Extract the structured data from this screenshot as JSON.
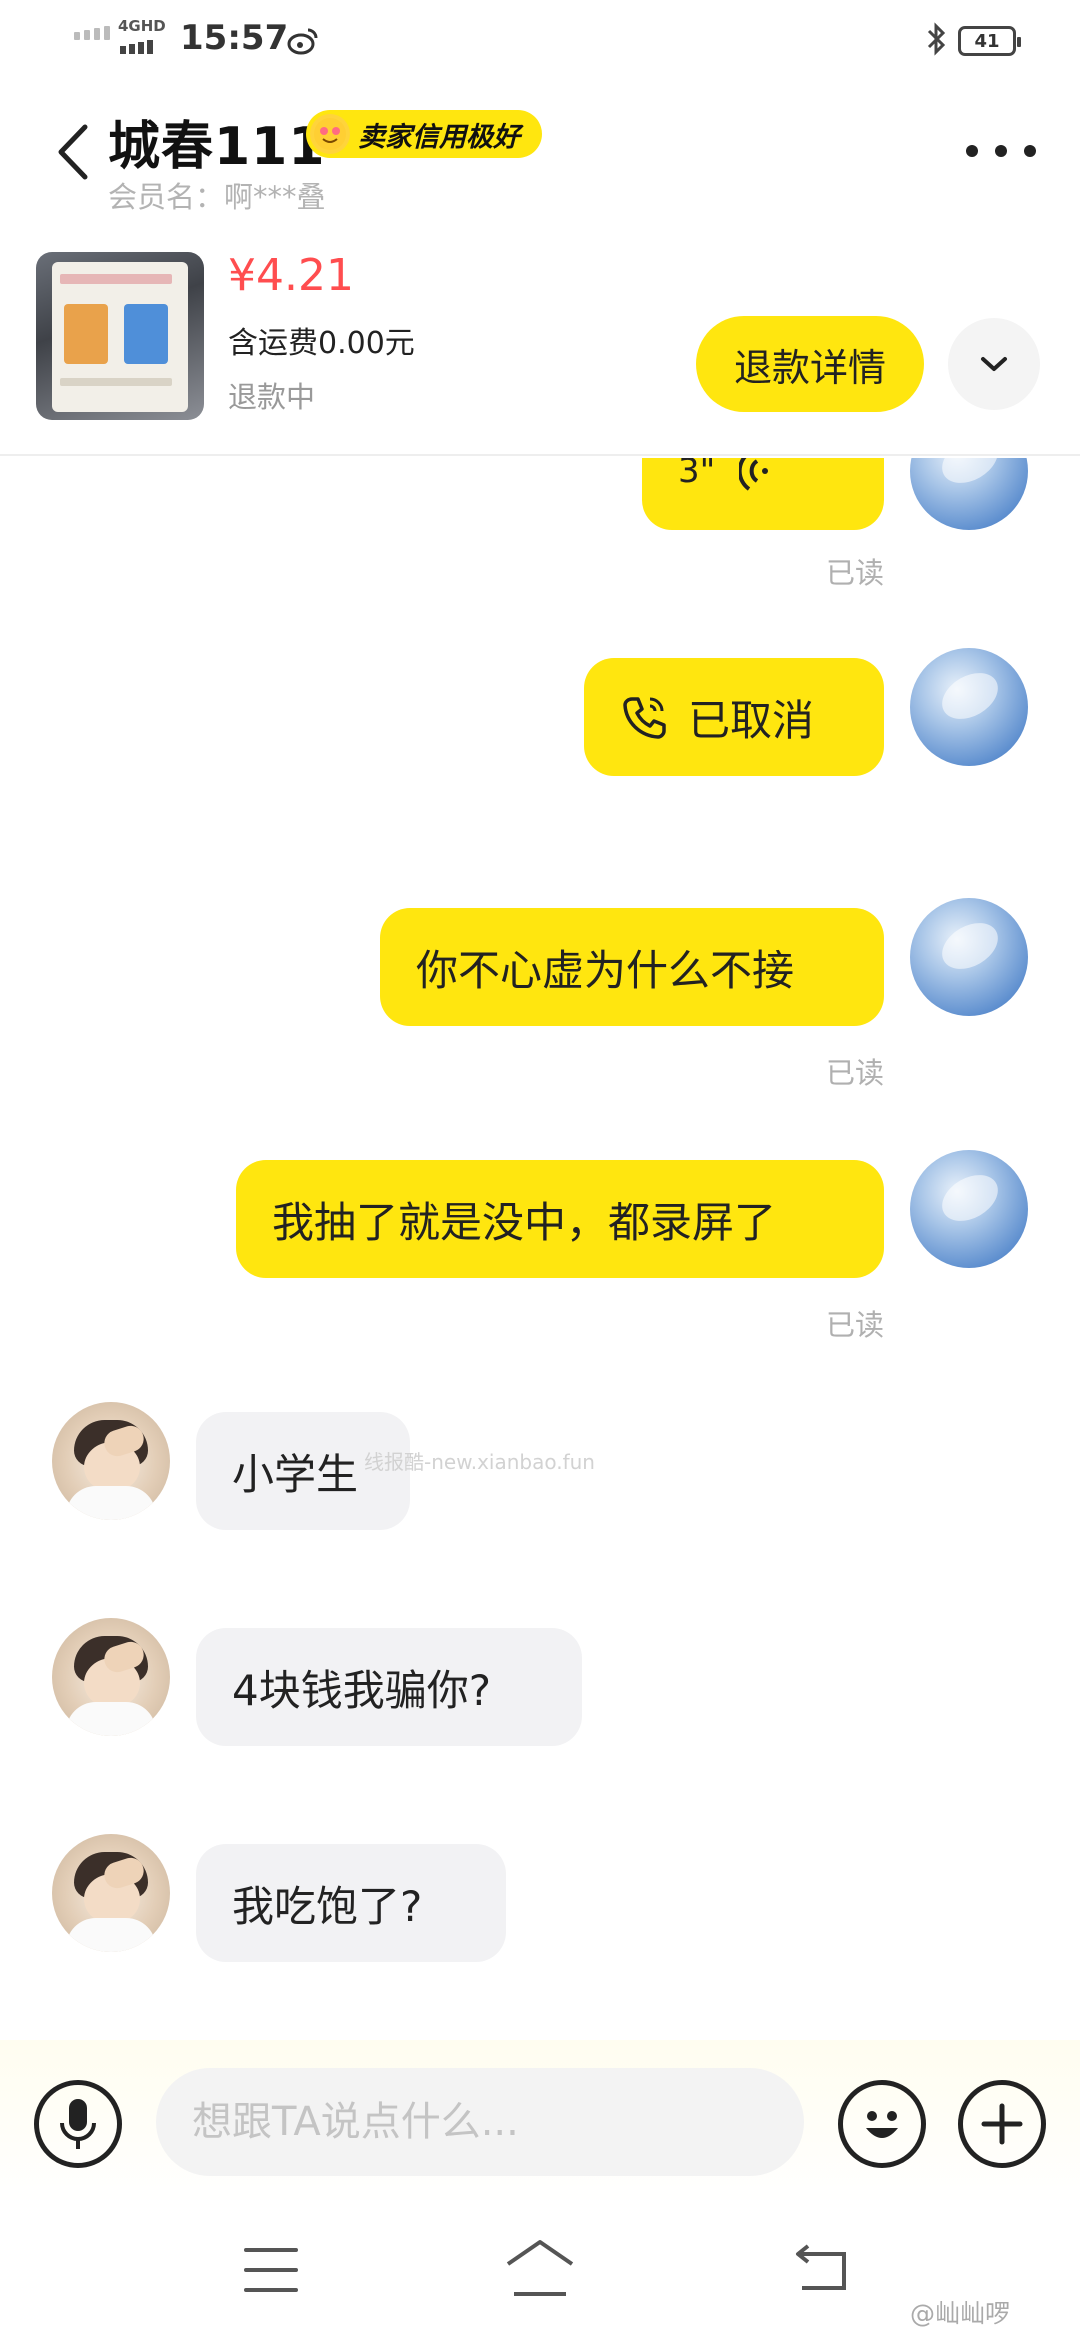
{
  "status_bar": {
    "network": "4GHD",
    "time": "15:57",
    "battery": "41"
  },
  "header": {
    "seller_name": "城春111",
    "credit_badge": "卖家信用极好",
    "member_name": "会员名：啊***叠"
  },
  "product": {
    "price": "¥4.21",
    "shipping": "含运费0.00元",
    "status": "退款中",
    "refund_button": "退款详情"
  },
  "messages": [
    {
      "id": 1,
      "direction": "out",
      "type": "voice",
      "duration": "3\"",
      "read": "已读"
    },
    {
      "id": 2,
      "direction": "out",
      "type": "call",
      "text": "已取消"
    },
    {
      "id": 3,
      "direction": "out",
      "type": "text",
      "text": "你不心虚为什么不接",
      "read": "已读"
    },
    {
      "id": 4,
      "direction": "out",
      "type": "text",
      "text": "我抽了就是没中，都录屏了",
      "read": "已读"
    },
    {
      "id": 5,
      "direction": "in",
      "type": "text",
      "text": "小学生"
    },
    {
      "id": 6,
      "direction": "in",
      "type": "text",
      "text": "4块钱我骗你?"
    },
    {
      "id": 7,
      "direction": "in",
      "type": "text",
      "text": "我吃饱了?"
    }
  ],
  "watermark": "线报酷-new.xianbao.fun",
  "input": {
    "placeholder": "想跟TA说点什么..."
  },
  "nav_bar": {
    "credit": "@屾屾啰"
  },
  "colors": {
    "accent": "#ffe60f",
    "price": "#ff4d4f",
    "incoming_bubble": "#f2f2f4"
  },
  "icons": [
    "back-arrow-icon",
    "more-icon",
    "chevron-down-icon",
    "voice-wave-icon",
    "phone-icon",
    "mic-icon",
    "emoji-icon",
    "plus-icon",
    "menu-icon",
    "home-icon",
    "back-nav-icon",
    "weibo-icon",
    "bluetooth-icon"
  ]
}
